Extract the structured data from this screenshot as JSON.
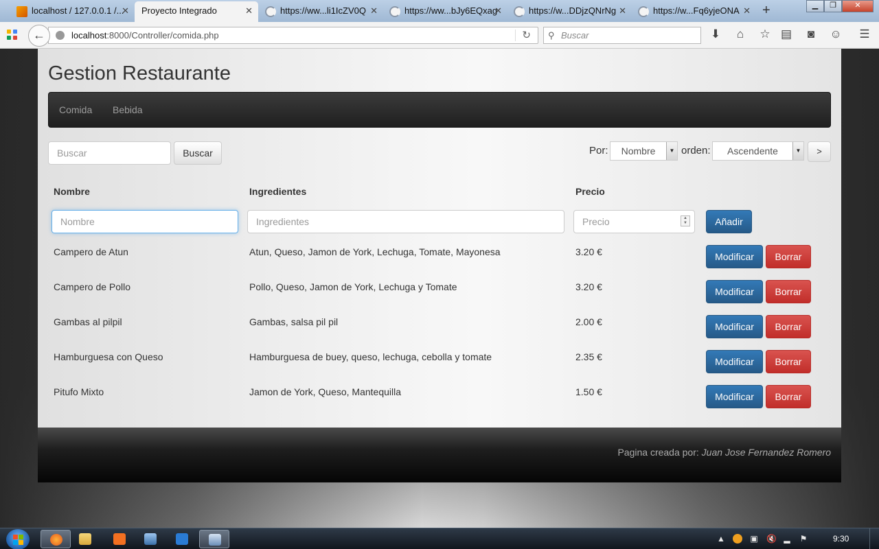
{
  "browser": {
    "tabs": [
      {
        "title": "localhost / 127.0.0.1 /...",
        "active": false,
        "icon": "phpmyadmin-icon"
      },
      {
        "title": "Proyecto Integrado",
        "active": true,
        "icon": ""
      },
      {
        "title": "https://ww...li1IcZV0Q",
        "active": false,
        "icon": "loading-icon"
      },
      {
        "title": "https://ww...bJy6EQxag",
        "active": false,
        "icon": "loading-icon"
      },
      {
        "title": "https://w...DDjzQNrNg",
        "active": false,
        "icon": "loading-icon"
      },
      {
        "title": "https://w...Fq6yjeONA",
        "active": false,
        "icon": "loading-icon"
      }
    ],
    "url_host": "localhost",
    "url_rest": ":8000/Controller/comida.php",
    "search_placeholder": "Buscar"
  },
  "page": {
    "title": "Gestion Restaurante",
    "nav": [
      "Comida",
      "Bebida"
    ],
    "search": {
      "placeholder": "Buscar",
      "button": "Buscar"
    },
    "sort": {
      "por_label": "Por:",
      "por_value": "Nombre",
      "orden_label": "orden:",
      "orden_value": "Ascendente",
      "go_button": ">"
    },
    "table": {
      "headers": [
        "Nombre",
        "Ingredientes",
        "Precio"
      ],
      "new_row": {
        "nombre_placeholder": "Nombre",
        "ingredientes_placeholder": "Ingredientes",
        "precio_placeholder": "Precio",
        "add_button": "Añadir"
      },
      "rows": [
        {
          "nombre": "Campero de Atun",
          "ingredientes": "Atun, Queso, Jamon de York, Lechuga, Tomate, Mayonesa",
          "precio": "3.20 €"
        },
        {
          "nombre": "Campero de Pollo",
          "ingredientes": "Pollo, Queso, Jamon de York, Lechuga y Tomate",
          "precio": "3.20 €"
        },
        {
          "nombre": "Gambas al pilpil",
          "ingredientes": "Gambas, salsa pil pil",
          "precio": "2.00 €"
        },
        {
          "nombre": "Hamburguesa con Queso",
          "ingredientes": "Hamburguesa de buey, queso, lechuga, cebolla y tomate",
          "precio": "2.35 €"
        },
        {
          "nombre": "Pitufo Mixto",
          "ingredientes": "Jamon de York, Queso, Mantequilla",
          "precio": "1.50 €"
        }
      ],
      "modify_button": "Modificar",
      "delete_button": "Borrar"
    },
    "footer": {
      "prefix": "Pagina creada por: ",
      "author": "Juan Jose Fernandez Romero"
    }
  },
  "taskbar": {
    "clock": "9:30"
  },
  "colors": {
    "primary": "#337ab7",
    "danger": "#d9534f",
    "navbar": "#222222"
  }
}
